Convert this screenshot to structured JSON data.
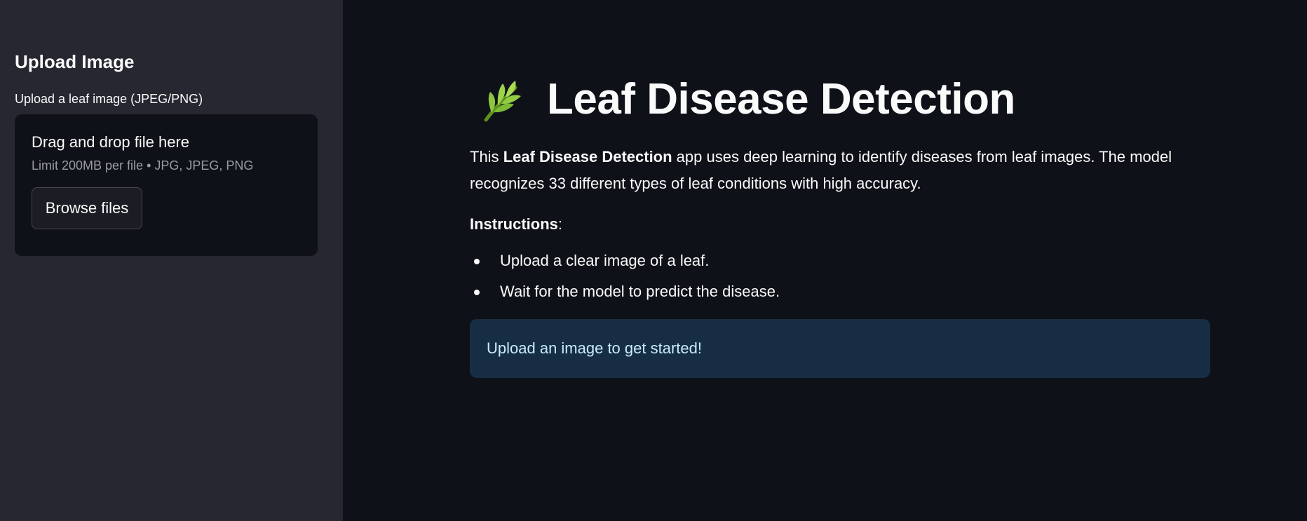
{
  "sidebar": {
    "title": "Upload Image",
    "uploader": {
      "label": "Upload a leaf image (JPEG/PNG)",
      "dropzone_title": "Drag and drop file here",
      "dropzone_limit": "Limit 200MB per file • JPG, JPEG, PNG",
      "browse_label": "Browse files"
    }
  },
  "main": {
    "title_icon": "herb-icon",
    "title": "Leaf Disease Detection",
    "description": {
      "prefix": "This ",
      "bold": "Leaf Disease Detection",
      "suffix": " app uses deep learning to identify diseases from leaf images. The model recognizes 33 different types of leaf conditions with high accuracy."
    },
    "instructions_heading": "Instructions",
    "instructions_colon": ":",
    "steps": [
      "Upload a clear image of a leaf.",
      "Wait for the model to predict the disease."
    ],
    "info_message": "Upload an image to get started!"
  },
  "colors": {
    "app_background": "#0e1117",
    "sidebar_background": "#262730",
    "info_background": "#172d43",
    "info_text": "#c7ebff"
  }
}
